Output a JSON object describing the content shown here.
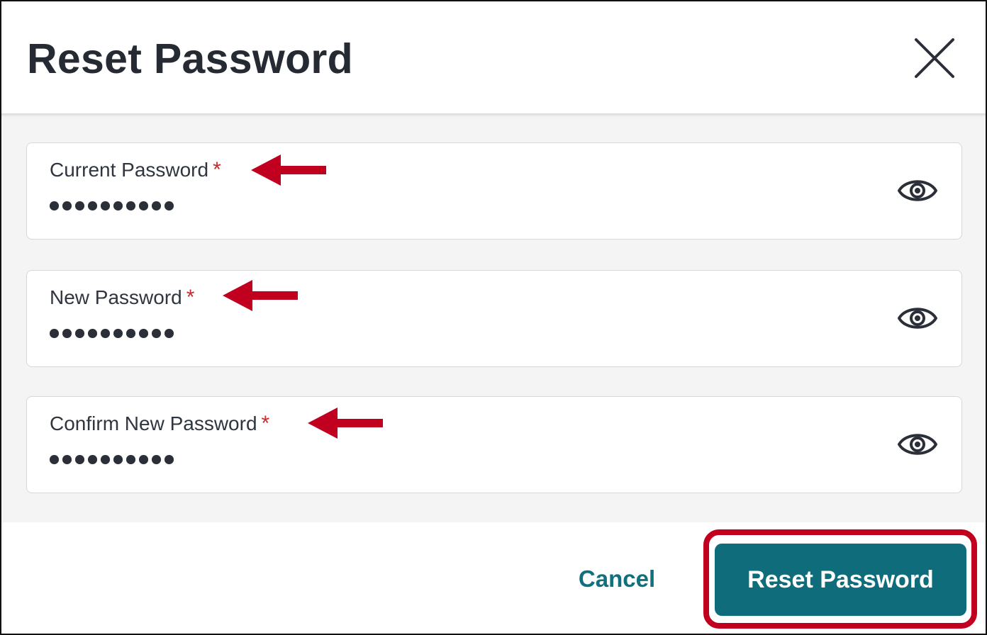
{
  "dialog": {
    "title": "Reset Password",
    "close_icon": "close-icon"
  },
  "fields": [
    {
      "label": "Current Password",
      "required_marker": "*",
      "value_masked": "••••••••••",
      "toggle_icon": "eye-icon"
    },
    {
      "label": "New Password",
      "required_marker": "*",
      "value_masked": "••••••••••",
      "toggle_icon": "eye-icon"
    },
    {
      "label": "Confirm New Password",
      "required_marker": "*",
      "value_masked": "••••••••••",
      "toggle_icon": "eye-icon"
    }
  ],
  "footer": {
    "cancel_label": "Cancel",
    "submit_label": "Reset Password"
  },
  "colors": {
    "accent": "#0f6d7b",
    "link": "#10707e",
    "required": "#cc2a2a",
    "annotation": "#c1001f"
  }
}
